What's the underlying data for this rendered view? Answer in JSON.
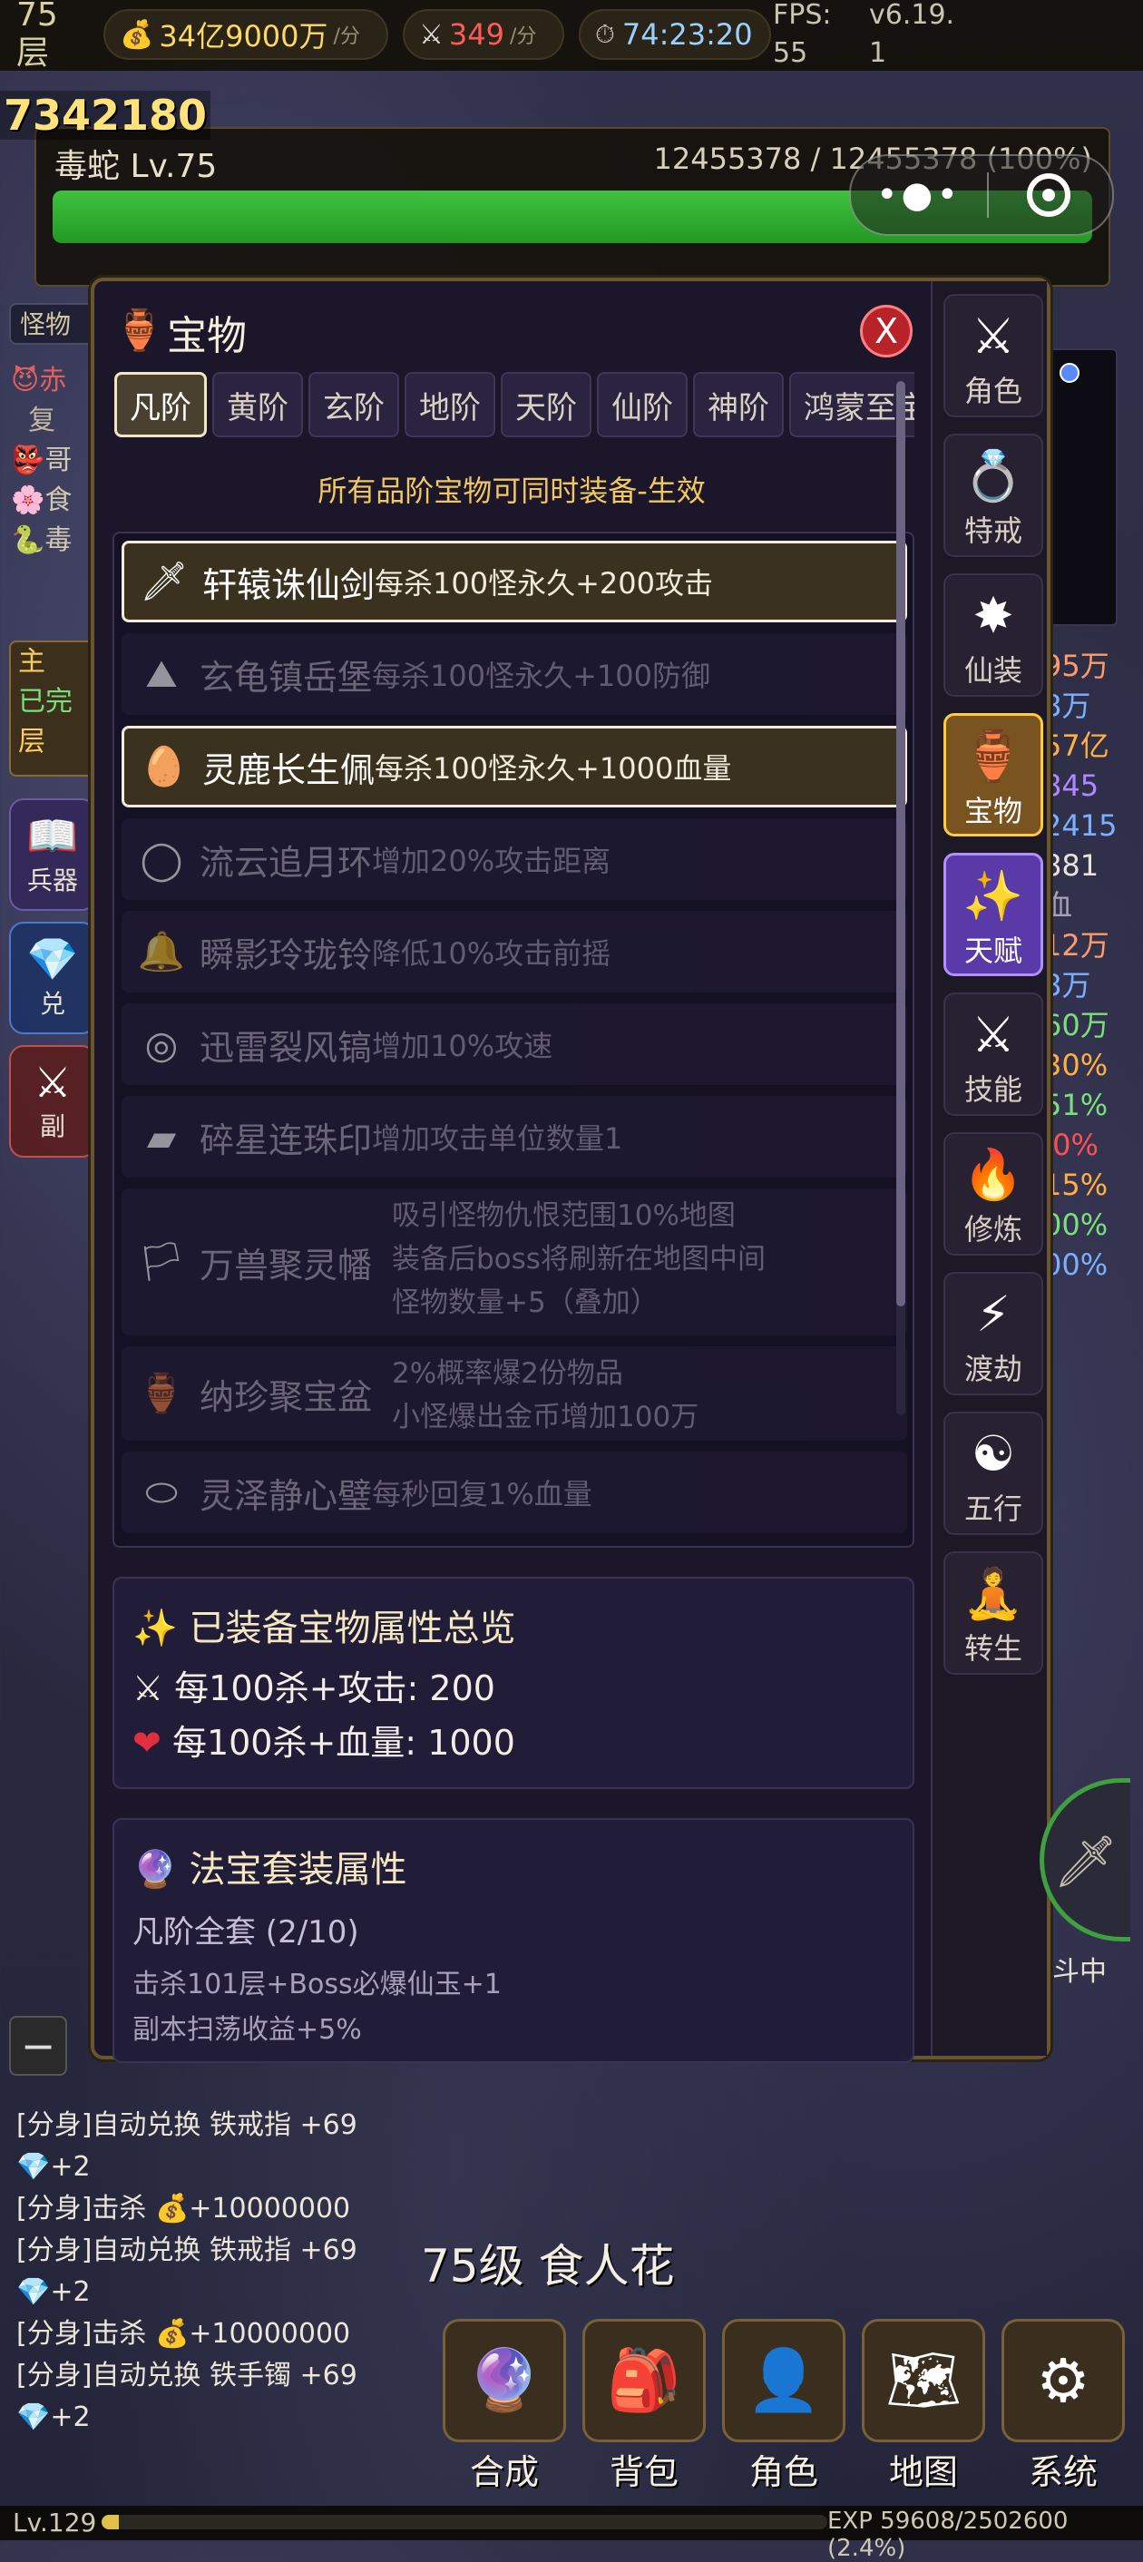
{
  "topbar": {
    "layer_num": "75",
    "layer_unit": "层",
    "gold": "34亿9000万",
    "gold_unit": "/分",
    "kills": "349",
    "kills_unit": "/分",
    "timer": "74:23:20",
    "fps_label": "FPS:",
    "fps_value": "55",
    "version": "v6.19.",
    "version_b": "1"
  },
  "big_number": "7342180",
  "boss": {
    "name": "毒蛇 Lv.75",
    "hp_text": "12455378 / 12455378 (100%)",
    "hp_fraction": 1.0
  },
  "left_tags": [
    "怪物",
    "赤",
    "复",
    "哥",
    "食",
    "毒",
    "主",
    "已完",
    "层",
    "兵器",
    "兑",
    "副"
  ],
  "right_stats": [
    {
      "text": "95万",
      "color": "#ff9a6a"
    },
    {
      "text": "8万",
      "color": "#7ab0ff"
    },
    {
      "text": "57亿",
      "color": "#ffb040"
    },
    {
      "text": "845",
      "color": "#b088ff"
    },
    {
      "text": "2415",
      "color": "#7ab0ff"
    },
    {
      "text": "881",
      "color": "#e8e2d8"
    },
    {
      "text": "血",
      "color": "#a8a0b8"
    },
    {
      "text": "12万",
      "color": "#ff9a6a"
    },
    {
      "text": "8万",
      "color": "#7ab0ff"
    },
    {
      "text": "60万",
      "color": "#7ae07a"
    },
    {
      "text": "30%",
      "color": "#ffb040"
    },
    {
      "text": "51%",
      "color": "#7ae07a"
    },
    {
      "text": ".0%",
      "color": "#ff5050"
    },
    {
      "text": "15%",
      "color": "#ffb040"
    },
    {
      "text": "00%",
      "color": "#7ae07a"
    },
    {
      "text": "00%",
      "color": "#7ab0ff"
    }
  ],
  "panel": {
    "title": "宝物",
    "close": "X",
    "tabs": [
      "凡阶",
      "黄阶",
      "玄阶",
      "地阶",
      "天阶",
      "仙阶",
      "神阶",
      "鸿蒙至宝"
    ],
    "hint": "所有品阶宝物可同时装备-生效",
    "items": [
      {
        "name": "轩辕诛仙剑",
        "desc": "每杀100怪永久+200攻击",
        "icon": "sword-icon",
        "glyph": "🗡",
        "equipped": true
      },
      {
        "name": "玄龟镇岳堡",
        "desc": "每杀100怪永久+100防御",
        "icon": "fortress-icon",
        "glyph": "⛰",
        "equipped": false
      },
      {
        "name": "灵鹿长生佩",
        "desc": "每杀100怪永久+1000血量",
        "icon": "pendant-icon",
        "glyph": "🥚",
        "equipped": true
      },
      {
        "name": "流云追月环",
        "desc": "增加20%攻击距离",
        "icon": "ring-icon",
        "glyph": "◯",
        "equipped": false
      },
      {
        "name": "瞬影玲珑铃",
        "desc": "降低10%攻击前摇",
        "icon": "bell-icon",
        "glyph": "🔔",
        "equipped": false
      },
      {
        "name": "迅雷裂风镐",
        "desc": "增加10%攻速",
        "icon": "bracelet-icon",
        "glyph": "◎",
        "equipped": false
      },
      {
        "name": "碎星连珠印",
        "desc": "增加攻击单位数量1",
        "icon": "seal-icon",
        "glyph": "▰",
        "equipped": false
      },
      {
        "name": "万兽聚灵幡",
        "desc_lines": [
          "吸引怪物仇恨范围10%地图",
          "装备后boss将刷新在地图中间",
          "怪物数量+5（叠加）"
        ],
        "icon": "banner-icon",
        "glyph": "🏳",
        "equipped": false
      },
      {
        "name": "纳珍聚宝盆",
        "desc_lines": [
          "2%概率爆2份物品",
          "小怪爆出金币增加100万"
        ],
        "icon": "treasure-bowl-icon",
        "glyph": "🏺",
        "equipped": false
      },
      {
        "name": "灵泽静心璧",
        "desc": "每秒回复1%血量",
        "icon": "jade-disc-icon",
        "glyph": "⬭",
        "equipped": false
      }
    ],
    "summary": {
      "title": "已装备宝物属性总览",
      "attack": "每100杀+攻击: 200",
      "hp": "每100杀+血量: 1000"
    },
    "set": {
      "title": "法宝套装属性",
      "name": "凡阶全套 (2/10)",
      "effect1": "击杀101层+Boss必爆仙玉+1",
      "effect2": "副本扫荡收益+5%"
    }
  },
  "nav": [
    {
      "label": "角色",
      "icon": "crossed-swords-icon",
      "glyph": "⚔",
      "style": "normal"
    },
    {
      "label": "特戒",
      "icon": "ring-icon",
      "glyph": "💍",
      "style": "normal"
    },
    {
      "label": "仙装",
      "icon": "burst-icon",
      "glyph": "✸",
      "style": "normal"
    },
    {
      "label": "宝物",
      "icon": "vase-icon",
      "glyph": "🏺",
      "style": "gold"
    },
    {
      "label": "天赋",
      "icon": "sparkles-icon",
      "glyph": "✨",
      "style": "purple"
    },
    {
      "label": "技能",
      "icon": "crossed-swords-icon",
      "glyph": "⚔",
      "style": "normal"
    },
    {
      "label": "修炼",
      "icon": "fire-icon",
      "glyph": "🔥",
      "style": "normal"
    },
    {
      "label": "渡劫",
      "icon": "lightning-icon",
      "glyph": "⚡",
      "style": "normal"
    },
    {
      "label": "五行",
      "icon": "yin-yang-icon",
      "glyph": "☯",
      "style": "normal"
    },
    {
      "label": "转生",
      "icon": "meditation-icon",
      "glyph": "🧘",
      "style": "normal"
    }
  ],
  "log": [
    "[分身]自动兑换 铁戒指 +69",
    "💎+2",
    "[分身]击杀 💰+10000000",
    "[分身]自动兑换 铁戒指 +69",
    "💎+2",
    "[分身]击杀 💰+10000000",
    "[分身]自动兑换 铁手镯 +69",
    "💎+2"
  ],
  "enemy_label": "75级 食人花",
  "fight_label": "斗中",
  "dock": [
    {
      "label": "合成",
      "icon": "crystal-ball-icon",
      "glyph": "🔮"
    },
    {
      "label": "背包",
      "icon": "backpack-icon",
      "glyph": "🎒"
    },
    {
      "label": "角色",
      "icon": "person-icon",
      "glyph": "👤"
    },
    {
      "label": "地图",
      "icon": "map-icon",
      "glyph": "🗺"
    },
    {
      "label": "系统",
      "icon": "gear-icon",
      "glyph": "⚙"
    }
  ],
  "xp": {
    "level": "Lv.129",
    "text": "EXP 59608/2502600 (2.4%)",
    "fraction": 0.024
  },
  "minus": "−",
  "capsule_dots": "•●•"
}
